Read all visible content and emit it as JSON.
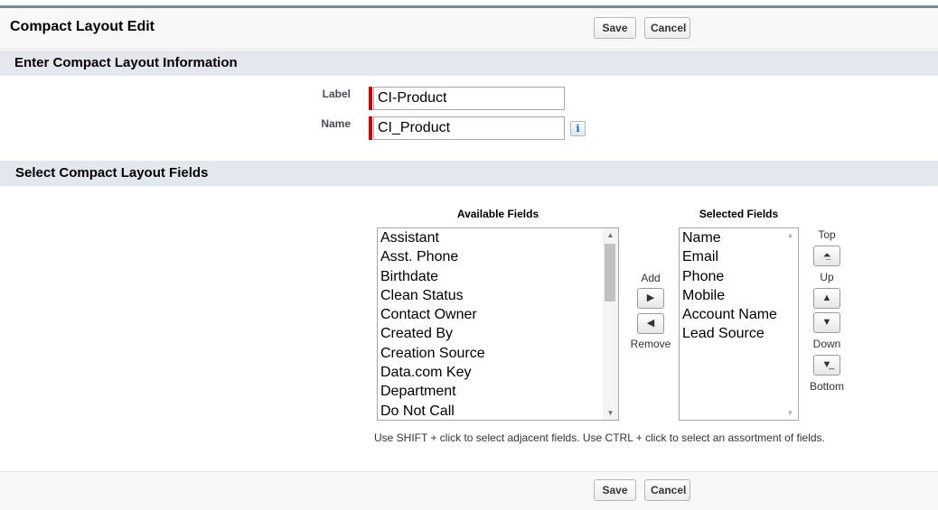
{
  "header": {
    "title": "Compact Layout Edit",
    "save_label": "Save",
    "cancel_label": "Cancel"
  },
  "info_section": {
    "title": "Enter Compact Layout Information",
    "label_field": {
      "label": "Label",
      "value": "CI-Product"
    },
    "name_field": {
      "label": "Name",
      "value": "CI_Product",
      "info_icon": "i"
    }
  },
  "fields_section": {
    "title": "Select Compact Layout Fields",
    "available": {
      "caption": "Available Fields",
      "items": [
        "Assistant",
        "Asst. Phone",
        "Birthdate",
        "Clean Status",
        "Contact Owner",
        "Created By",
        "Creation Source",
        "Data.com Key",
        "Department",
        "Do Not Call"
      ]
    },
    "selected": {
      "caption": "Selected Fields",
      "items": [
        "Name",
        "Email",
        "Phone",
        "Mobile",
        "Account Name",
        "Lead Source"
      ]
    },
    "add_label": "Add",
    "remove_label": "Remove",
    "top_label": "Top",
    "up_label": "Up",
    "down_label": "Down",
    "bottom_label": "Bottom",
    "hint": "Use SHIFT + click to select adjacent fields. Use CTRL + click to select an assortment of fields."
  },
  "footer": {
    "save_label": "Save",
    "cancel_label": "Cancel"
  },
  "icons": {
    "right": "arrow-right-icon",
    "left": "arrow-left-icon",
    "top": "move-top-icon",
    "up": "arrow-up-icon",
    "down": "arrow-down-icon",
    "bottom": "move-bottom-icon"
  },
  "colors": {
    "section_bar": "#e3e8ef",
    "required_marker": "#cc0000",
    "header_rule": "#7a8699"
  }
}
